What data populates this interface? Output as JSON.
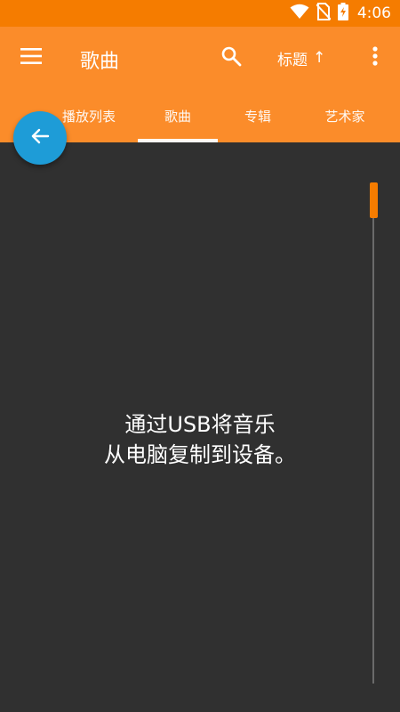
{
  "status_bar": {
    "time": "4:06"
  },
  "app_bar": {
    "title": "歌曲",
    "sort_label": "标题",
    "sort_arrow": "↑"
  },
  "tabs": [
    {
      "label": "播放列表"
    },
    {
      "label": "歌曲",
      "selected": true
    },
    {
      "label": "专辑"
    },
    {
      "label": "艺术家"
    }
  ],
  "empty_state": {
    "line1": "通过USB将音乐",
    "line2": "从电脑复制到设备。"
  },
  "colors": {
    "accent": "#F57C00",
    "app_bar": "#FB8C2A",
    "fab": "#1E9CD7",
    "background": "#303030"
  },
  "icons": [
    "wifi-icon",
    "no-sim-icon",
    "battery-charging-icon",
    "menu-icon",
    "search-icon",
    "more-vert-icon",
    "arrow-back-icon"
  ]
}
